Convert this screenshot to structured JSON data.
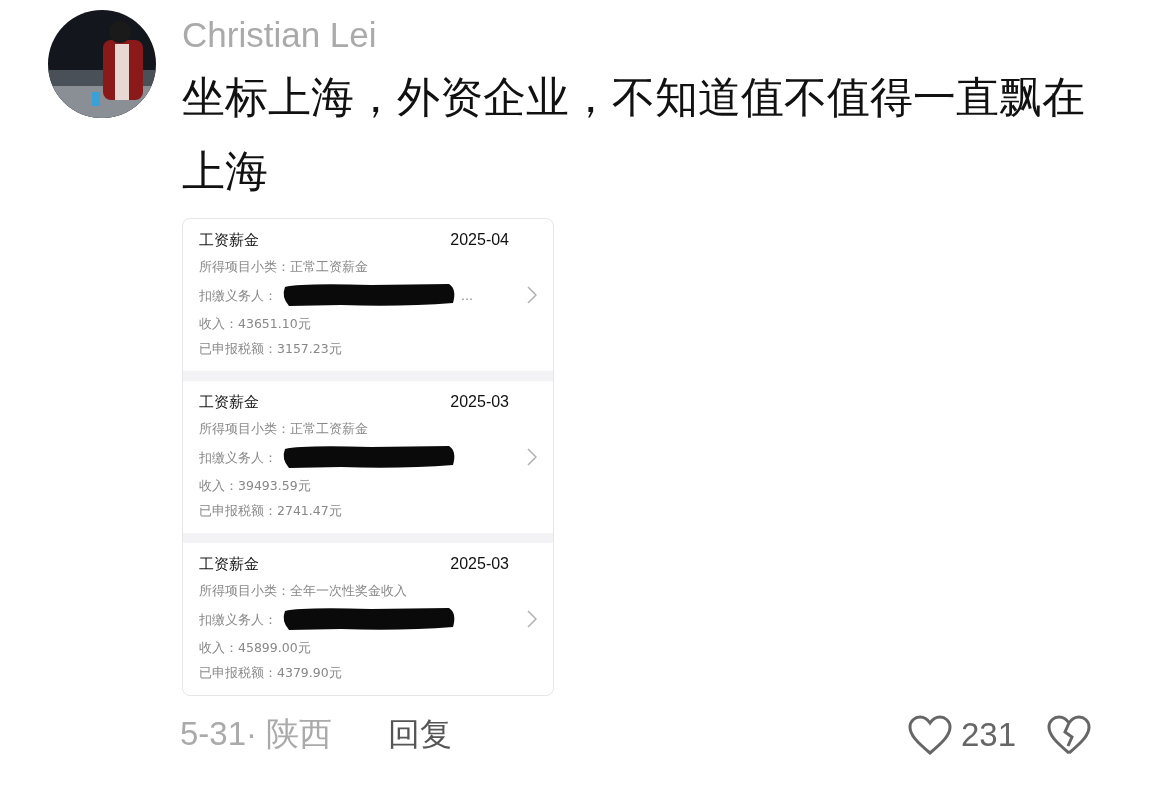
{
  "author": {
    "name": "Christian Lei"
  },
  "comment": "坐标上海，外资企业，不知道值不值得一直飘在上海",
  "attachment": {
    "records": [
      {
        "title": "工资薪金",
        "date": "2025-04",
        "subtype": "所得项目小类：正常工资薪金",
        "payer_label": "扣缴义务人：",
        "payer_tail": "...",
        "income": "收入：43651.10元",
        "tax": "已申报税额：3157.23元"
      },
      {
        "title": "工资薪金",
        "date": "2025-03",
        "subtype": "所得项目小类：正常工资薪金",
        "payer_label": "扣缴义务人：",
        "income": "收入：39493.59元",
        "tax": "已申报税额：2741.47元"
      },
      {
        "title": "工资薪金",
        "date": "2025-03",
        "subtype": "所得项目小类：全年一次性奖金收入",
        "payer_label": "扣缴义务人：",
        "income": "收入：45899.00元",
        "tax": "已申报税额：4379.90元"
      }
    ]
  },
  "footer": {
    "date_location": "5-31· 陕西",
    "reply": "回复",
    "likes": "231"
  }
}
